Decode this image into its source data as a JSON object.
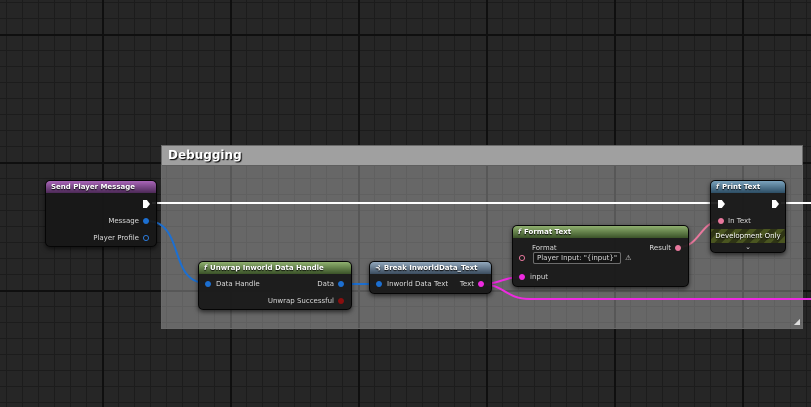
{
  "comment": {
    "title": "Debugging"
  },
  "nodes": {
    "send_player_message": {
      "title": "Send Player Message",
      "pins": {
        "message": "Message",
        "player_profile": "Player Profile"
      }
    },
    "unwrap_data_handle": {
      "title": "Unwrap Inworld Data Handle",
      "pins": {
        "data_handle": "Data Handle",
        "data": "Data",
        "unwrap_successful": "Unwrap Successful"
      }
    },
    "break_data_text": {
      "title": "Break InworldData_Text",
      "pins": {
        "inworld_data_text": "Inworld Data Text",
        "text": "Text"
      }
    },
    "format_text": {
      "title": "Format Text",
      "pins": {
        "format": "Format",
        "format_value": "Player Input: \"{input}\"",
        "result": "Result",
        "input": "input"
      }
    },
    "print_text": {
      "title": "Print Text",
      "pins": {
        "in_text": "In Text"
      },
      "banner": "Development Only"
    }
  },
  "colors": {
    "exec": "#ffffff",
    "struct": "#1c6fd1",
    "text": "#ee2ae0",
    "boolean": "#8a0f0f",
    "function_header": "#7ba3bd",
    "event_header": "#a966b9"
  },
  "icons": {
    "function": "f-icon",
    "break": "break-struct-icon",
    "warning": "warning-icon",
    "expand": "chevron-down-icon",
    "resize": "resize-grip-icon"
  }
}
